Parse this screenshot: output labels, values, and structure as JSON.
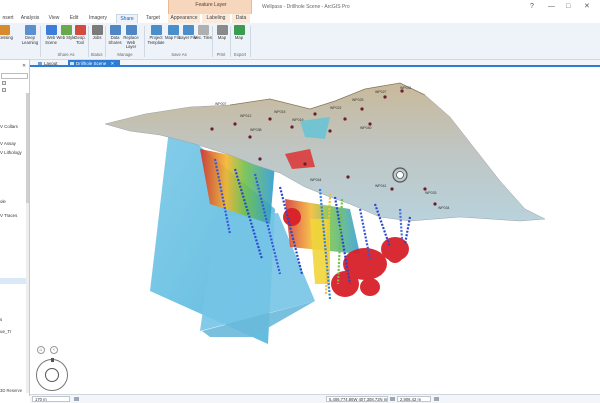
{
  "window": {
    "context_group": "Feature Layer",
    "title": "Wellpass - Drillhole Scene - ArcGIS Pro",
    "controls": [
      "?",
      "—",
      "□",
      "✕"
    ]
  },
  "tabs": [
    {
      "label": "nsert"
    },
    {
      "label": "Analysis"
    },
    {
      "label": "View"
    },
    {
      "label": "Edit"
    },
    {
      "label": "Imagery"
    },
    {
      "label": "Share",
      "active": true
    },
    {
      "label": "Target"
    },
    {
      "label": "Appearance"
    },
    {
      "label": "Labeling"
    },
    {
      "label": "Data"
    }
  ],
  "ribbon": {
    "buttons": [
      {
        "label": "rocessing",
        "color": "#d88b2c"
      },
      {
        "label": "Deep Learning",
        "color": "#5b8fd0"
      },
      {
        "label": "Web Scene",
        "color": "#3b7dd8"
      },
      {
        "label": "Web Style",
        "color": "#6aa94b"
      },
      {
        "label": "Geop. Tool",
        "color": "#d24b3e"
      },
      {
        "label": "Jobs",
        "color": "#7a7a7a"
      },
      {
        "label": "Data Shares",
        "color": "#4f86c6"
      },
      {
        "label": "Replace Web Layer",
        "color": "#4f86c6"
      },
      {
        "label": "Project Template",
        "color": "#4a8fc9"
      },
      {
        "label": "Map File",
        "color": "#4a8fc9"
      },
      {
        "label": "Layer File",
        "color": "#4a8fc9"
      },
      {
        "label": "Vec. Tiles",
        "color": "#b0b0b0"
      },
      {
        "label": "Map",
        "color": "#8a8a8a"
      },
      {
        "label": "Map",
        "color": "#3b9b4f"
      }
    ],
    "groups": [
      "Share As",
      "Status",
      "Manage",
      "Save As",
      "Print",
      "Export"
    ]
  },
  "view_tabs": [
    {
      "label": "Layout",
      "active": false
    },
    {
      "label": "Drillhole Scene",
      "active": true
    }
  ],
  "contents": {
    "items": [
      "V Collars",
      "V Assay",
      "V Lithology",
      "ole",
      "V Traces",
      "s",
      "ue_Tr"
    ],
    "bottom_label": "3D Reserve"
  },
  "scene": {
    "collar_labels": [
      "WP007",
      "WP012",
      "WP015",
      "WP019",
      "WP022",
      "WP025",
      "WP027",
      "WP031",
      "WP033",
      "WP034",
      "WP038",
      "WP040",
      "WP041",
      "WP044"
    ]
  },
  "status": {
    "scale": "170 m",
    "coordinates": "5,406,774.86W 407,308.72N m",
    "elevation": "2,906.42 m"
  }
}
